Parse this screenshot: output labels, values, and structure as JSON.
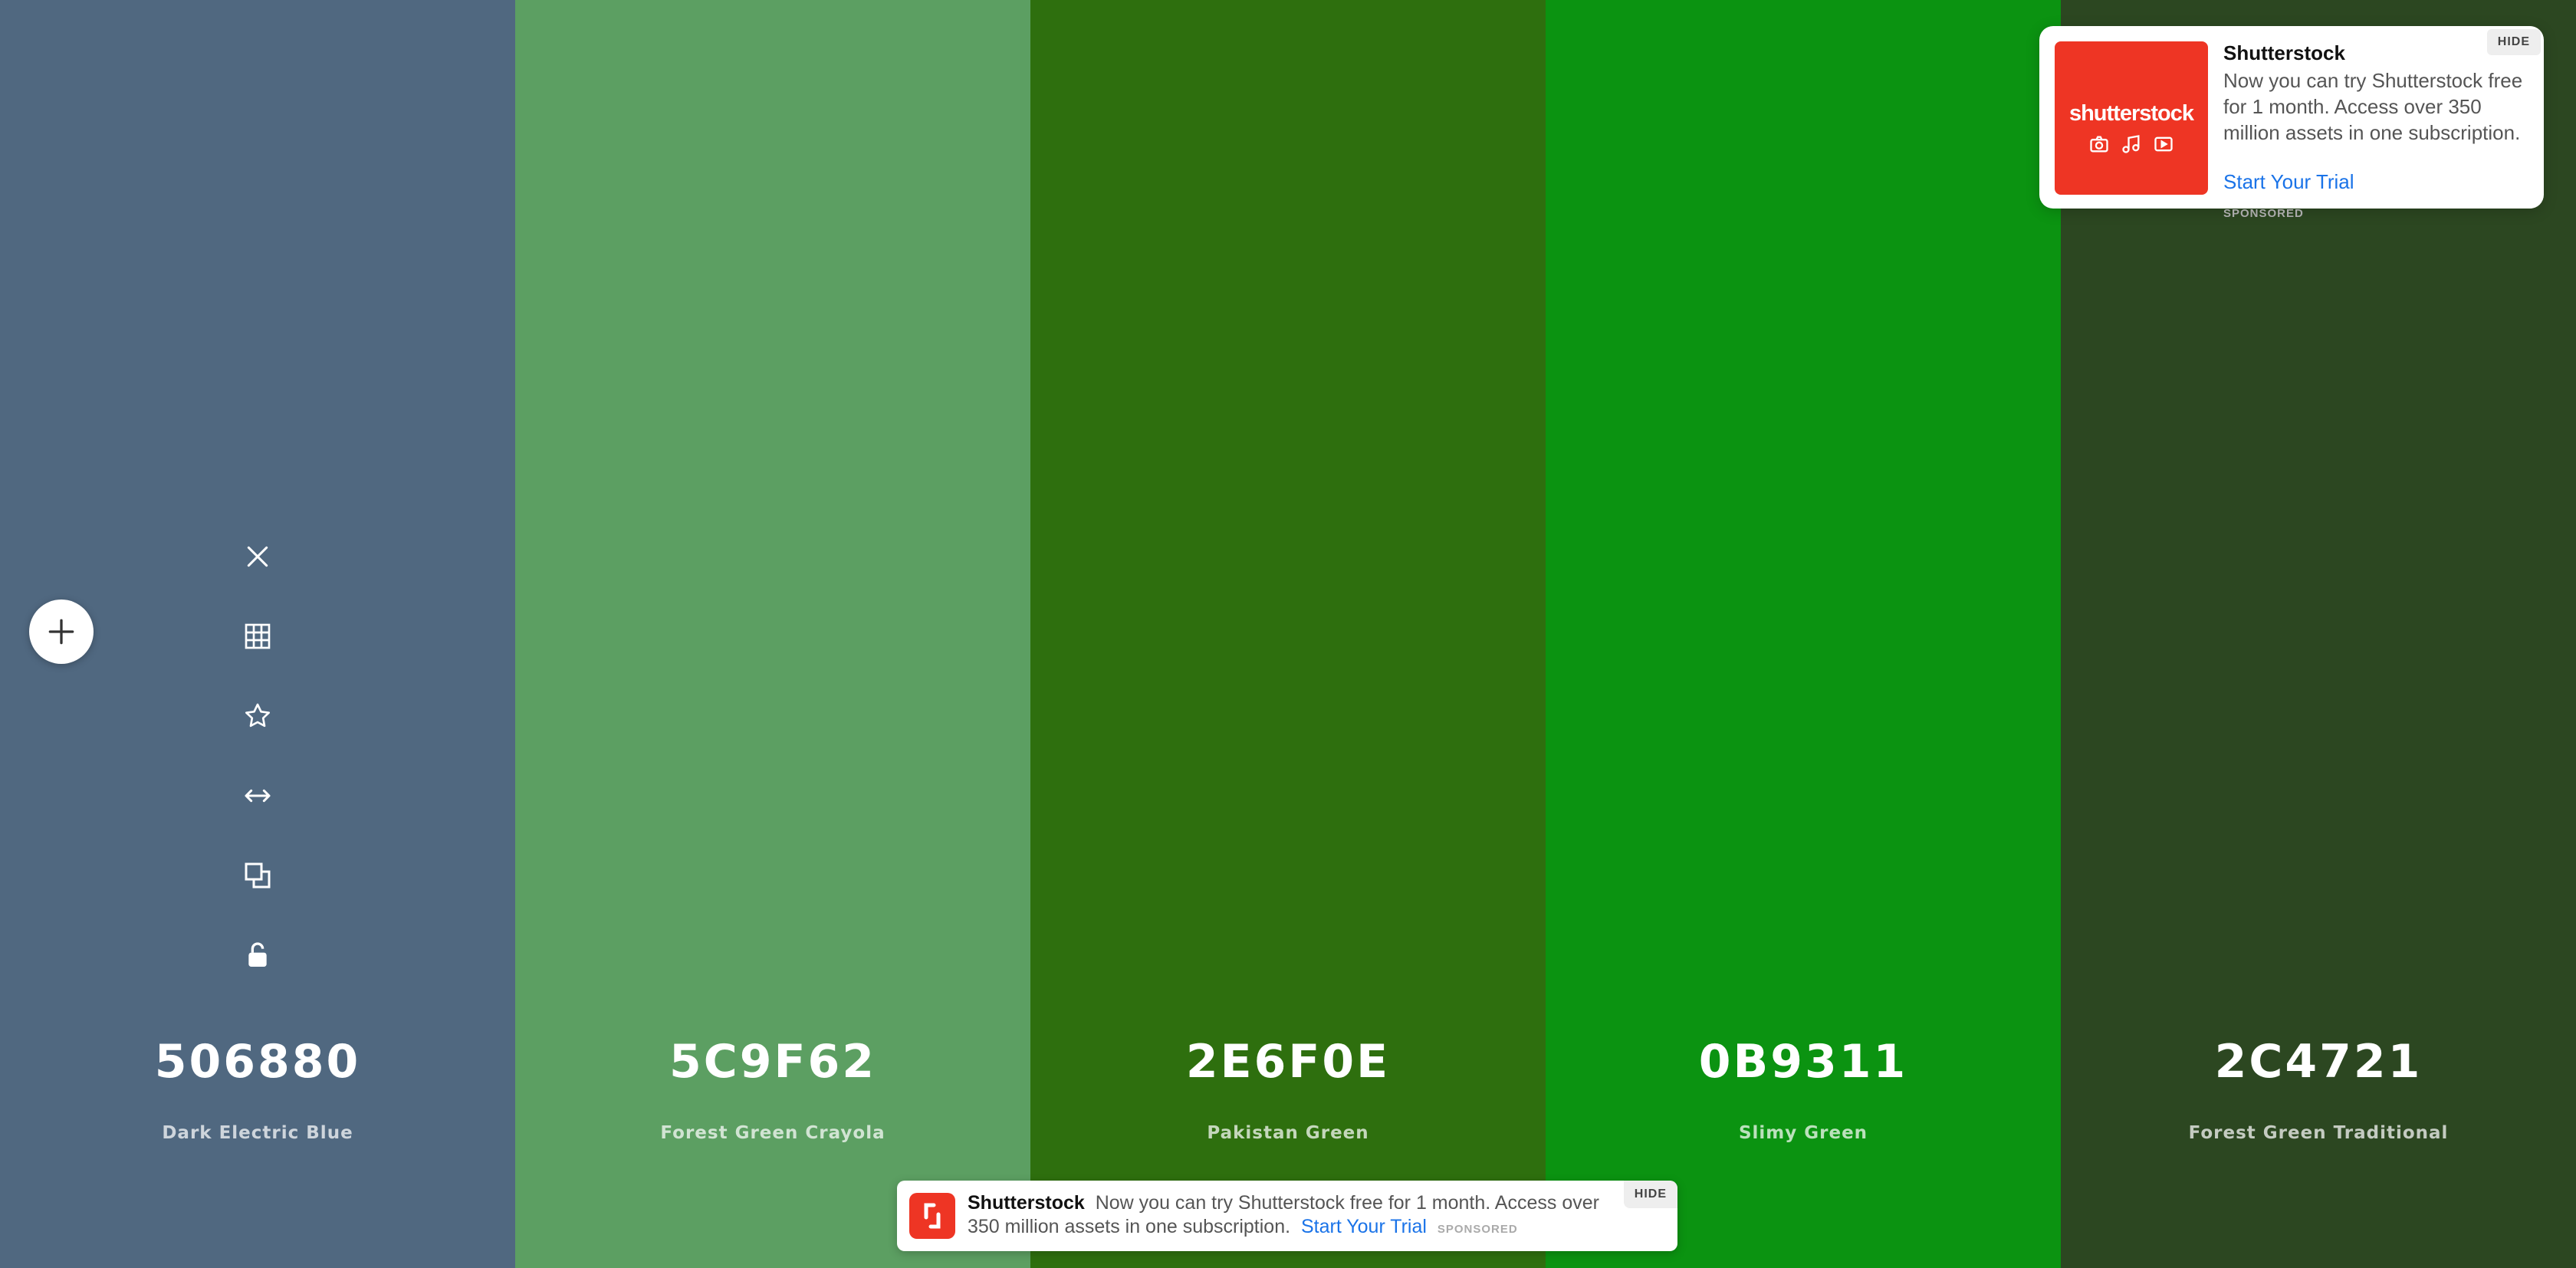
{
  "palette": {
    "swatches": [
      {
        "hex": "506880",
        "name": "Dark Electric Blue",
        "color": "#506880"
      },
      {
        "hex": "5C9F62",
        "name": "Forest Green Crayola",
        "color": "#5c9f62"
      },
      {
        "hex": "2E6F0E",
        "name": "Pakistan Green",
        "color": "#2e6f0e"
      },
      {
        "hex": "0B9311",
        "name": "Slimy Green",
        "color": "#0b9311"
      },
      {
        "hex": "2C4721",
        "name": "Forest Green Traditional",
        "color": "#2c4721"
      }
    ]
  },
  "toolbar": {
    "icons": [
      "close-icon",
      "grid-icon",
      "star-icon",
      "arrows-horizontal-icon",
      "copy-icon",
      "unlock-icon"
    ]
  },
  "sidebar_ad": {
    "title": "Shutterstock",
    "logo_text": "shutterstock",
    "text": "Now you can try Shutterstock free for 1 month. Access over 350 million assets in one subscription.",
    "cta": "Start Your Trial",
    "sponsored": "SPONSORED",
    "hide": "HIDE"
  },
  "banner_ad": {
    "title": "Shutterstock",
    "text": "Now you can try Shutterstock free for 1 month. Access over 350 million assets in one subscription.",
    "cta": "Start Your Trial",
    "sponsored": "SPONSORED",
    "hide": "HIDE"
  },
  "colors": {
    "accent_link": "#1a73e8",
    "brand_red": "#ee3524"
  }
}
